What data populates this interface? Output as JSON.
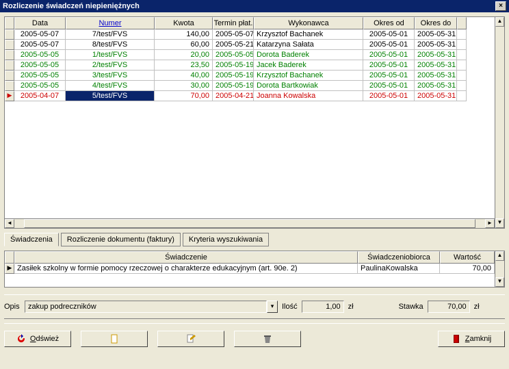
{
  "window": {
    "title": "Rozliczenie świadczeń niepieniężnych"
  },
  "grid": {
    "headers": {
      "data": "Data",
      "numer": "Numer",
      "kwota": "Kwota",
      "termin": "Termin płat.",
      "wykonawca": "Wykonawca",
      "okres_od": "Okres od",
      "okres_do": "Okres do"
    },
    "rows": [
      {
        "data": "2005-05-07",
        "numer": "7/test/FVS",
        "kwota": "140,00",
        "termin": "2005-05-07",
        "wykonawca": "Krzysztof Bachanek",
        "okres_od": "2005-05-01",
        "okres_do": "2005-05-31",
        "color": "black",
        "selected": false,
        "marker": ""
      },
      {
        "data": "2005-05-07",
        "numer": "8/test/FVS",
        "kwota": "60,00",
        "termin": "2005-05-21",
        "wykonawca": "Katarzyna Sałata",
        "okres_od": "2005-05-01",
        "okres_do": "2005-05-31",
        "color": "black",
        "selected": false,
        "marker": ""
      },
      {
        "data": "2005-05-05",
        "numer": "1/test/FVS",
        "kwota": "20,00",
        "termin": "2005-05-05",
        "wykonawca": "Dorota Baderek",
        "okres_od": "2005-05-01",
        "okres_do": "2005-05-31",
        "color": "green",
        "selected": false,
        "marker": ""
      },
      {
        "data": "2005-05-05",
        "numer": "2/test/FVS",
        "kwota": "23,50",
        "termin": "2005-05-19",
        "wykonawca": "Jacek Baderek",
        "okres_od": "2005-05-01",
        "okres_do": "2005-05-31",
        "color": "green",
        "selected": false,
        "marker": ""
      },
      {
        "data": "2005-05-05",
        "numer": "3/test/FVS",
        "kwota": "40,00",
        "termin": "2005-05-19",
        "wykonawca": "Krzysztof Bachanek",
        "okres_od": "2005-05-01",
        "okres_do": "2005-05-31",
        "color": "green",
        "selected": false,
        "marker": ""
      },
      {
        "data": "2005-05-05",
        "numer": "4/test/FVS",
        "kwota": "30,00",
        "termin": "2005-05-19",
        "wykonawca": "Dorota Bartkowiak",
        "okres_od": "2005-05-01",
        "okres_do": "2005-05-31",
        "color": "green",
        "selected": false,
        "marker": ""
      },
      {
        "data": "2005-04-07",
        "numer": "5/test/FVS",
        "kwota": "70,00",
        "termin": "2005-04-21",
        "wykonawca": "Joanna Kowalska",
        "okres_od": "2005-05-01",
        "okres_do": "2005-05-31",
        "color": "red",
        "selected": true,
        "marker": "▶"
      }
    ]
  },
  "tabs": {
    "t1": "Świadczenia",
    "t2": "Rozliczenie dokumentu (faktury)",
    "t3": "Kryteria wyszukiwania"
  },
  "detail": {
    "headers": {
      "swiadczenie": "Świadczenie",
      "biorca": "Świadczeniobiorca",
      "wartosc": "Wartość"
    },
    "row": {
      "marker": "▶",
      "swiadczenie": "Zasiłek szkolny w formie pomocy rzeczowej o charakterze edukacyjnym (art. 90e. 2)",
      "biorca": "PaulinaKowalska",
      "wartosc": "70,00"
    }
  },
  "form": {
    "opis_label": "Opis",
    "opis_value": "zakup podreczników",
    "ilosc_label": "Ilość",
    "ilosc_value": "1,00",
    "unit": "zł",
    "stawka_label": "Stawka",
    "stawka_value": "70,00",
    "stawka_unit": "zł"
  },
  "buttons": {
    "refresh": "Odśwież",
    "close": "Zamknij"
  }
}
